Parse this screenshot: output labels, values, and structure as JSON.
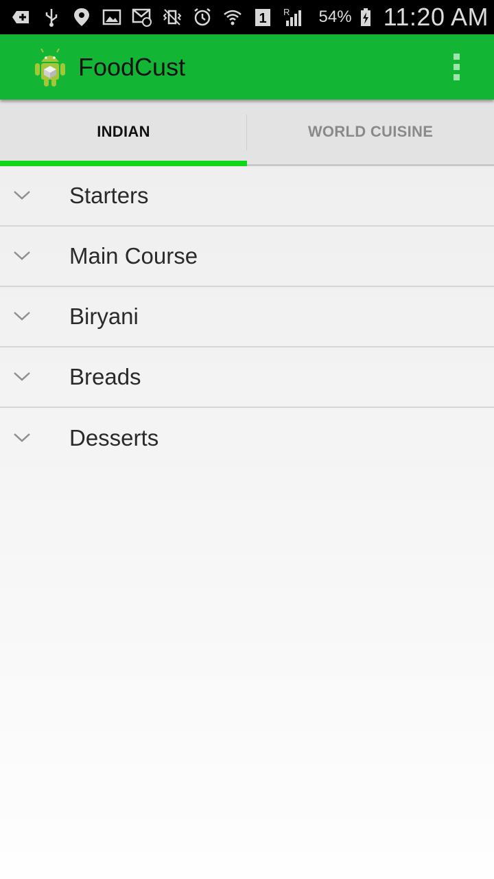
{
  "status_bar": {
    "icons": [
      "add-icon",
      "usb-icon",
      "location-icon",
      "image-icon",
      "email-icon",
      "vibrate-icon",
      "alarm-icon",
      "wifi-icon",
      "sim-icon",
      "signal-icon"
    ],
    "sim_slot": "1",
    "roaming": "R",
    "battery_percent": "54%",
    "time": "11:20 AM"
  },
  "action_bar": {
    "title": "FoodCust",
    "color": "#13b534"
  },
  "tabs": [
    {
      "label": "INDIAN",
      "active": true
    },
    {
      "label": "WORLD CUISINE",
      "active": false
    }
  ],
  "categories": [
    {
      "label": "Starters"
    },
    {
      "label": "Main Course"
    },
    {
      "label": "Biryani"
    },
    {
      "label": "Breads"
    },
    {
      "label": "Desserts"
    }
  ],
  "colors": {
    "accent": "#11d61a",
    "action_bar": "#13b534"
  }
}
